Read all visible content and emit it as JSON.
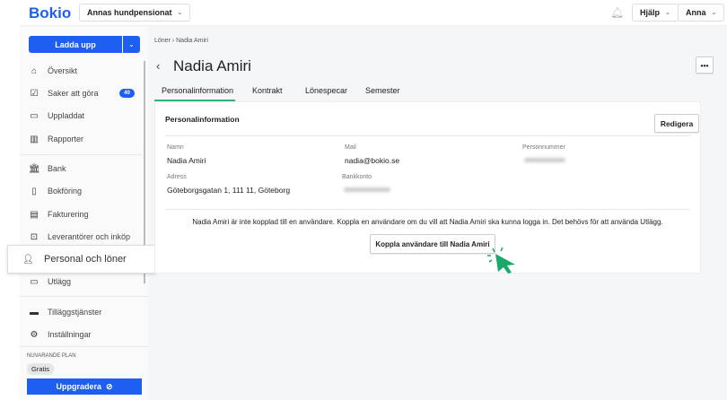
{
  "header": {
    "logo": "Bokio",
    "company": "Annas hundpensionat",
    "help": "Hjälp",
    "user": "Anna"
  },
  "sidebar": {
    "upload": "Ladda upp",
    "items": [
      {
        "label": "Översikt",
        "icon": "home-icon"
      },
      {
        "label": "Saker att göra",
        "icon": "calendar-check-icon",
        "badge": "40"
      },
      {
        "label": "Uppladdat",
        "icon": "folder-icon"
      },
      {
        "label": "Rapporter",
        "icon": "bar-chart-icon"
      },
      {
        "label": "Bank",
        "icon": "bank-icon"
      },
      {
        "label": "Bokföring",
        "icon": "book-icon"
      },
      {
        "label": "Fakturering",
        "icon": "invoice-icon"
      },
      {
        "label": "Leverantörer och inköp",
        "icon": "inbox-icon"
      },
      {
        "label": "Personal och löner",
        "icon": "person-icon"
      },
      {
        "label": "Utlägg",
        "icon": "card-icon"
      },
      {
        "label": "Tilläggstjänster",
        "icon": "store-icon"
      },
      {
        "label": "Inställningar",
        "icon": "gear-icon"
      }
    ],
    "plan_label": "NUVARANDE PLAN",
    "plan": "Gratis",
    "upgrade": "Uppgradera"
  },
  "main": {
    "breadcrumb": "Löner › Nadia Amiri",
    "title": "Nadia Amiri",
    "tabs": [
      "Personalinformation",
      "Kontrakt",
      "Lönespecar",
      "Semester"
    ],
    "card": {
      "title": "Personalinformation",
      "edit": "Redigera",
      "fields": {
        "name_label": "Namn",
        "name": "Nadia Amiri",
        "mail_label": "Mail",
        "mail": "nadia@bokio.se",
        "pnr_label": "Personnummer",
        "address_label": "Adress",
        "address": "Göteborgsgatan 1, 111 11, Göteborg",
        "bank_label": "Bankkonto"
      },
      "message": "Nadia Amiri är inte kopplad till en användare. Koppla en användare om du vill att Nadia Amiri ska kunna logga in. Det behövs för att använda Utlägg.",
      "connect": "Koppla användare till Nadia Amiri"
    }
  },
  "colors": {
    "primary": "#1e5ef0",
    "tab_active": "#2bb673",
    "cursor": "#1aa86b"
  }
}
